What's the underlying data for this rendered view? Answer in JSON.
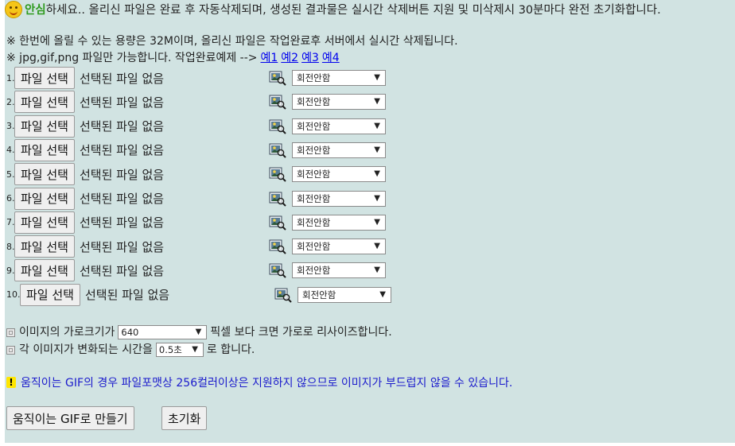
{
  "notice": {
    "safe_label": "안심",
    "text": "하세요.. 올리신 파일은 완료 후 자동삭제되며, 생성된 결과물은 실시간 삭제버튼 지원 및 미삭제시 30분마다 완전 초기화합니다."
  },
  "info": {
    "line1": "※ 한번에 올릴 수 있는 용량은 32M이며, 올리신 파일은 작업완료후 서버에서 실시간 삭제됩니다.",
    "line2": "※ jpg,gif,png 파일만 가능합니다. 작업완료예제 -->",
    "examples": [
      "예1",
      "예2",
      "예3",
      "예4"
    ]
  },
  "file_rows": [
    {
      "num": "1.",
      "button": "파일 선택",
      "status": "선택된 파일 없음",
      "rotation": "회전안함"
    },
    {
      "num": "2.",
      "button": "파일 선택",
      "status": "선택된 파일 없음",
      "rotation": "회전안함"
    },
    {
      "num": "3.",
      "button": "파일 선택",
      "status": "선택된 파일 없음",
      "rotation": "회전안함"
    },
    {
      "num": "4.",
      "button": "파일 선택",
      "status": "선택된 파일 없음",
      "rotation": "회전안함"
    },
    {
      "num": "5.",
      "button": "파일 선택",
      "status": "선택된 파일 없음",
      "rotation": "회전안함"
    },
    {
      "num": "6.",
      "button": "파일 선택",
      "status": "선택된 파일 없음",
      "rotation": "회전안함"
    },
    {
      "num": "7.",
      "button": "파일 선택",
      "status": "선택된 파일 없음",
      "rotation": "회전안함"
    },
    {
      "num": "8.",
      "button": "파일 선택",
      "status": "선택된 파일 없음",
      "rotation": "회전안함"
    },
    {
      "num": "9.",
      "button": "파일 선택",
      "status": "선택된 파일 없음",
      "rotation": "회전안함"
    },
    {
      "num": "10.",
      "button": "파일 선택",
      "status": "선택된 파일 없음",
      "rotation": "회전안함"
    }
  ],
  "options": {
    "width_prefix": "이미지의 가로크기가",
    "width_value": "640",
    "width_suffix": "픽셀 보다 크면 가로로 리사이즈합니다.",
    "time_prefix": "각 이미지가 변화되는 시간을",
    "time_value": "0.5초",
    "time_suffix": "로 합니다."
  },
  "warning": {
    "icon": "!",
    "text": "움직이는 GIF의 경우 파일포맷상 256컬러이상은 지원하지 않으므로 이미지가 부드럽지 않을 수 있습니다."
  },
  "actions": {
    "make_gif": "움직이는 GIF로 만들기",
    "reset": "초기화"
  },
  "colors": {
    "panel_bg": "#d1e3e2",
    "safe_green": "#2e9a1e",
    "warning_blue": "#1a1acc",
    "link_blue": "#0000ee"
  }
}
